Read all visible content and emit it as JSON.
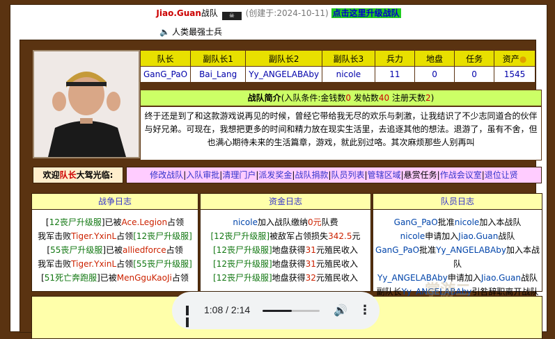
{
  "header": {
    "guild_name": "Jiao.Guan",
    "guild_word": "战队",
    "flag_icon": "pirate-flag-icon",
    "created": "(创建于:2024-10-11)",
    "upgrade_link": "点击这里升级战队",
    "slogan": "人类最强士兵"
  },
  "info_table": {
    "headers": [
      "队长",
      "副队长1",
      "副队长2",
      "副队长3",
      "兵力",
      "地盘",
      "任务",
      "资产"
    ],
    "values": [
      "GanG_PaO",
      "Bai_Lang",
      "Yy_ANGELABAby",
      "nicole",
      "11",
      "0",
      "0",
      "1545"
    ]
  },
  "intro": {
    "title": "战队简介",
    "cond_prefix": "(入队条件:金钱数",
    "money": "0",
    "posts_label": " 发帖数",
    "posts": "40",
    "days_label": " 注册天数",
    "days": "2",
    "cond_suffix": ")",
    "text": "终于还是到了和这款游戏说再见的时候，曾经它带给我无尽的欢乐与刺激，让我结识了不少志同道合的伙伴与好兄弟。可现在，我想把更多的时间和精力放在现实生活里，去追逐其他的想法。退游了，虽有不舍，但也满心期待未来的生活篇章，游戏，就此别过咯。其次麻烦那些人别再叫"
  },
  "welcome": {
    "prefix": "欢迎",
    "role": "队长",
    "suffix": "大驾光临:"
  },
  "menu": {
    "items": [
      "修改战队",
      "入队审批",
      "清理门户",
      "派发奖金",
      "战队捐款",
      "队员列表",
      "管辖区域",
      "悬赏任务",
      "作战会议室",
      "退位让贤"
    ],
    "sep": "|"
  },
  "logs": {
    "war": {
      "title": "战争日志",
      "lines": [
        [
          "[",
          "12丧尸升级服",
          "]已被",
          "Ace.Legion",
          "占领"
        ],
        [
          "我军击败",
          "Tiger.YxinL",
          "占领",
          "[12丧尸升级服]",
          ""
        ],
        [
          "[",
          "55丧尸升级服",
          "]已被",
          "alliedforce",
          "占领"
        ],
        [
          "我军击败",
          "Tiger.YxinL",
          "占领",
          "[55丧尸升级服]",
          ""
        ],
        [
          "[",
          "51死亡奔跑服",
          "]已被",
          "MenGguKaoJi",
          "占领"
        ]
      ]
    },
    "fund": {
      "title": "资金日志",
      "lines": [
        [
          "nicole",
          "加入战队缴纳",
          "0元",
          "队费"
        ],
        [
          "[12丧尸升级服]",
          "被敌军占领损失",
          "342.5",
          "元"
        ],
        [
          "[12丧尸升级服]",
          "地盘获得",
          "31",
          "元殖民收入"
        ],
        [
          "[12丧尸升级服]",
          "地盘获得",
          "31",
          "元殖民收入"
        ],
        [
          "[12丧尸升级服]",
          "地盘获得",
          "32",
          "元殖民收入"
        ]
      ]
    },
    "member": {
      "title": "队员日志",
      "lines": [
        [
          "GanG_PaO",
          "批准",
          "nicole",
          "加入本战队"
        ],
        [
          "nicole",
          "申请加入",
          "Jiao.Guan",
          "战队"
        ],
        [
          "GanG_PaO",
          "批准",
          "Yy_ANGELABAby",
          "加入本战队"
        ],
        [
          "Yy_ANGELABAby",
          "申请加入",
          "Jiao.Guan",
          "战队"
        ],
        [
          "副队长",
          "Yy_ANGELABAby",
          "引咎辞职离开战队",
          ""
        ]
      ]
    }
  },
  "player": {
    "current": "1:08",
    "total": "2:14",
    "progress": 0.51
  },
  "watermark": "掌游二"
}
